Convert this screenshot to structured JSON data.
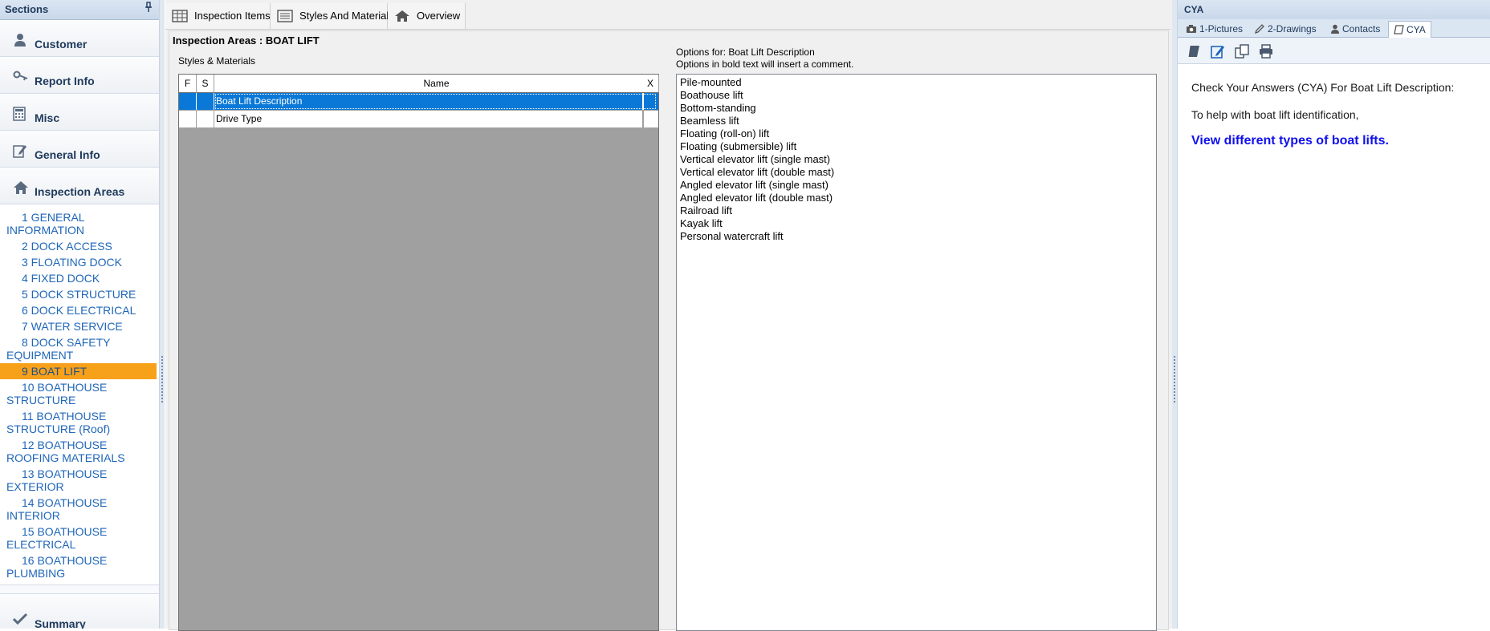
{
  "sidebar": {
    "title": "Sections",
    "pin_icon": "pin-icon",
    "sections": [
      {
        "label": "Customer",
        "icon": "user-icon"
      },
      {
        "label": "Report Info",
        "icon": "key-icon"
      },
      {
        "label": "Misc",
        "icon": "calculator-icon"
      },
      {
        "label": "General Info",
        "icon": "edit-icon"
      },
      {
        "label": "Inspection Areas",
        "icon": "home-icon"
      }
    ],
    "areas": [
      "1 GENERAL INFORMATION",
      "2 DOCK ACCESS",
      "3 FLOATING DOCK",
      "4 FIXED DOCK",
      "5 DOCK STRUCTURE",
      "6 DOCK ELECTRICAL",
      "7 WATER SERVICE",
      "8 DOCK SAFETY EQUIPMENT",
      "9 BOAT LIFT",
      "10 BOATHOUSE STRUCTURE",
      "11 BOATHOUSE STRUCTURE (Roof)",
      "12 BOATHOUSE ROOFING MATERIALS",
      "13 BOATHOUSE EXTERIOR",
      "14 BOATHOUSE INTERIOR",
      "15 BOATHOUSE ELECTRICAL",
      "16 BOATHOUSE PLUMBING"
    ],
    "active_area": "9 BOAT LIFT",
    "summary": {
      "label": "Summary",
      "icon": "checkmark-icon"
    }
  },
  "center": {
    "tabs": [
      {
        "label": "Inspection Items",
        "icon": "table-icon"
      },
      {
        "label": "Styles And Materials",
        "icon": "list-icon"
      },
      {
        "label": "Overview",
        "icon": "home-icon"
      }
    ],
    "page_title": "Inspection Areas : BOAT LIFT",
    "styles_label": "Styles & Materials",
    "grid": {
      "columns": [
        "F",
        "S",
        "Name",
        "X"
      ],
      "rows": [
        {
          "name": "Boat Lift Description",
          "selected": true
        },
        {
          "name": "Drive Type",
          "selected": false
        }
      ]
    },
    "options_title_line1": "Options for: Boat Lift Description",
    "options_title_line2": "Options in bold text will insert a comment.",
    "options": [
      "Pile-mounted",
      "Boathouse lift",
      "Bottom-standing",
      "Beamless lift",
      "Floating (roll-on) lift",
      "Floating (submersible) lift",
      "Vertical elevator lift (single mast)",
      "Vertical elevator lift (double mast)",
      "Angled elevator lift (single mast)",
      "Angled elevator lift (double mast)",
      "Railroad lift",
      "Kayak lift",
      "Personal watercraft lift"
    ]
  },
  "right": {
    "title": "CYA",
    "tabs": [
      {
        "label": "1-Pictures",
        "icon": "camera-icon"
      },
      {
        "label": "2-Drawings",
        "icon": "pencil-icon"
      },
      {
        "label": "Contacts",
        "icon": "person-icon"
      },
      {
        "label": "CYA",
        "icon": "book-icon"
      }
    ],
    "active_tab": "CYA",
    "tools": [
      "book-icon",
      "edit-icon",
      "copy-icon",
      "print-icon"
    ],
    "cya_heading": "Check Your Answers (CYA) For Boat Lift Description:",
    "cya_text": "To help with boat lift identification,",
    "cya_link": "View different types of boat lifts."
  },
  "colors": {
    "accent_active": "#f7a11a",
    "selection": "#0a78d7",
    "link": "#1010ee",
    "nav_text": "#1e395b"
  }
}
